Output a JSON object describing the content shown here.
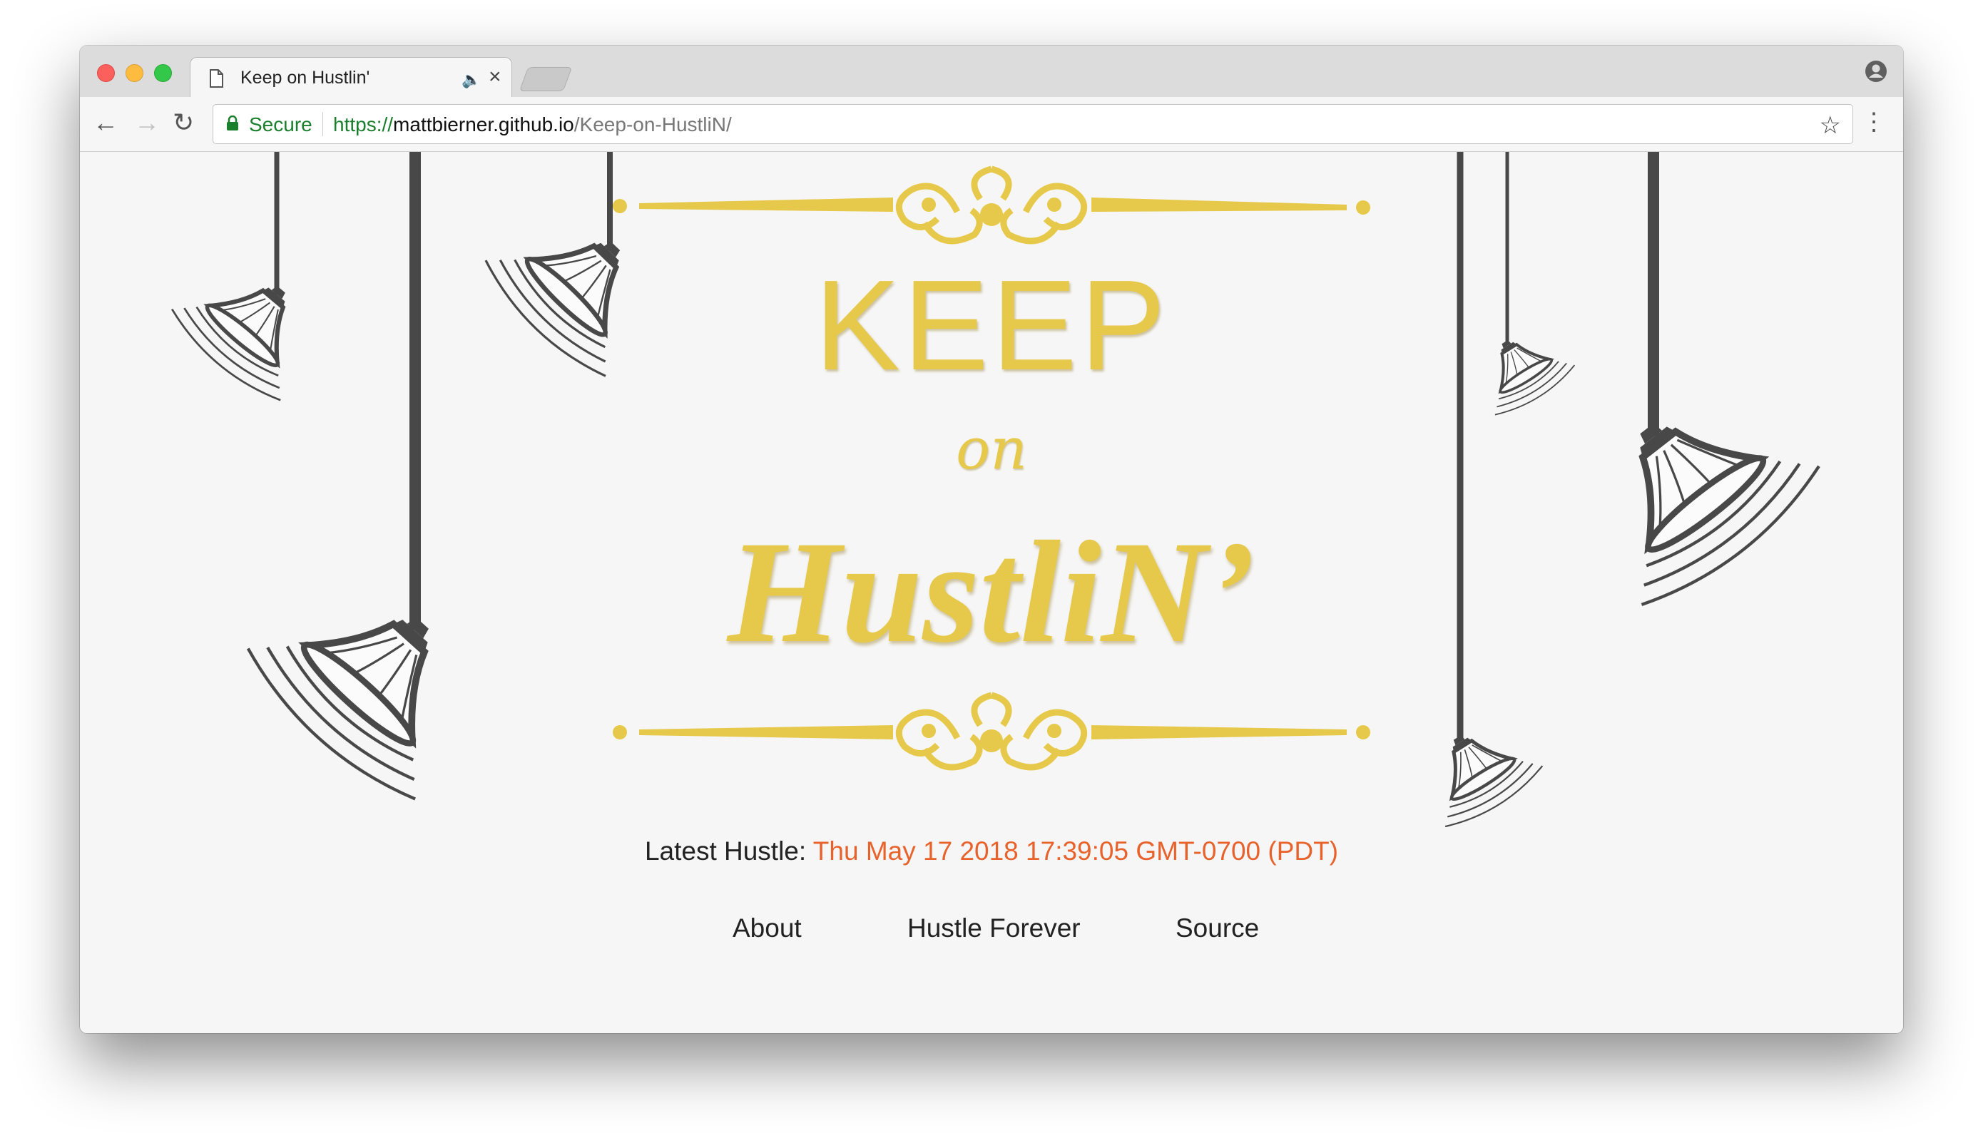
{
  "browser": {
    "tab": {
      "title": "Keep on Hustlin'",
      "audio_icon": "speaker-icon",
      "close_icon": "close-icon"
    },
    "toolbar": {
      "back_icon": "back-arrow-icon",
      "forward_icon": "forward-arrow-icon",
      "reload_icon": "reload-icon",
      "secure_label": "Secure",
      "url_scheme": "https://",
      "url_host": "mattbierner.github.io",
      "url_path": "/Keep-on-HustliN/",
      "bookmark_icon": "star-icon",
      "menu_icon": "kebab-menu-icon"
    }
  },
  "page": {
    "heading": {
      "line1": "KEEP",
      "line2": "on",
      "line3": "HustliN’"
    },
    "latest_label": "Latest Hustle:",
    "latest_value": "Thu May 17 2018 17:39:05 GMT-0700 (PDT)",
    "links": [
      "About",
      "Hustle Forever",
      "Source"
    ],
    "decoration": "hanging-bell-lamps",
    "colors": {
      "gold": "#e6c94a",
      "accent": "#e8622c",
      "ink": "#484848"
    }
  }
}
